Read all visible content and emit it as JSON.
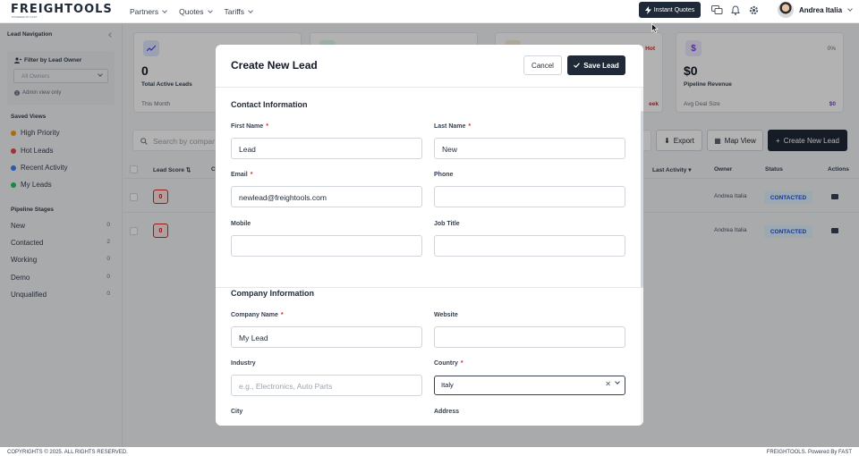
{
  "brand": {
    "logo": "FREIGHTOOLS",
    "tagline": "POWERED BY FAST"
  },
  "nav": {
    "items": [
      {
        "label": "Partners"
      },
      {
        "label": "Quotes"
      },
      {
        "label": "Tariffs"
      }
    ],
    "instant_quotes": "Instant Quotes"
  },
  "user": {
    "name": "Andrea Italia"
  },
  "sidebar": {
    "title": "Lead Navigation",
    "filter": {
      "label": "Filter by Lead Owner",
      "selected": "All Owners",
      "note": "Admin view only"
    },
    "saved_views": {
      "title": "Saved Views",
      "items": [
        {
          "label": "High Priority",
          "color": "#f59e0b"
        },
        {
          "label": "Hot Leads",
          "color": "#ef4444"
        },
        {
          "label": "Recent Activity",
          "color": "#3b82f6"
        },
        {
          "label": "My Leads",
          "color": "#22c55e"
        }
      ]
    },
    "pipeline": {
      "title": "Pipeline Stages",
      "stages": [
        {
          "label": "New",
          "count": "0"
        },
        {
          "label": "Contacted",
          "count": "2"
        },
        {
          "label": "Working",
          "count": "0"
        },
        {
          "label": "Demo",
          "count": "0"
        },
        {
          "label": "Unqualified",
          "count": "0"
        }
      ]
    }
  },
  "stats": {
    "active": {
      "value": "0",
      "label": "Total Active Leads",
      "foot": "This Month"
    },
    "hot": {
      "tag": "Hot",
      "foot": "eek"
    },
    "revenue": {
      "value": "$0",
      "label": "Pipeline Revenue",
      "percent": "0%",
      "foot_label": "Avg Deal Size",
      "foot_value": "$0"
    }
  },
  "toolbar": {
    "search_placeholder": "Search by compar",
    "export": "Export",
    "map_view": "Map View",
    "create": "Create New Lead"
  },
  "table": {
    "headers": {
      "score": "Lead Score",
      "c": "C",
      "last_activity": "Last Activity",
      "owner": "Owner",
      "status": "Status",
      "actions": "Actions"
    },
    "rows": [
      {
        "score": "0",
        "owner": "Andrea Italia",
        "status": "CONTACTED"
      },
      {
        "score": "0",
        "owner": "Andrea Italia",
        "status": "CONTACTED"
      }
    ]
  },
  "modal": {
    "title": "Create New Lead",
    "cancel": "Cancel",
    "save": "Save Lead",
    "contact_section": "Contact Information",
    "company_section": "Company Information",
    "fields": {
      "first_name": {
        "label": "First Name",
        "value": "Lead"
      },
      "last_name": {
        "label": "Last Name",
        "value": "New"
      },
      "email": {
        "label": "Email",
        "value": "newlead@freightools.com"
      },
      "phone": {
        "label": "Phone",
        "value": ""
      },
      "mobile": {
        "label": "Mobile",
        "value": ""
      },
      "job_title": {
        "label": "Job Title",
        "value": ""
      },
      "company_name": {
        "label": "Company Name",
        "value": "My Lead"
      },
      "website": {
        "label": "Website",
        "value": ""
      },
      "industry": {
        "label": "Industry",
        "placeholder": "e.g., Electronics, Auto Parts"
      },
      "country": {
        "label": "Country",
        "value": "Italy"
      },
      "city": {
        "label": "City"
      },
      "address": {
        "label": "Address"
      }
    }
  },
  "footer": {
    "copyright": "COPYRIGHTS © 2025. ALL RIGHTS RESERVED.",
    "powered": "FREIGHTOOLS. Powered By FAST"
  }
}
